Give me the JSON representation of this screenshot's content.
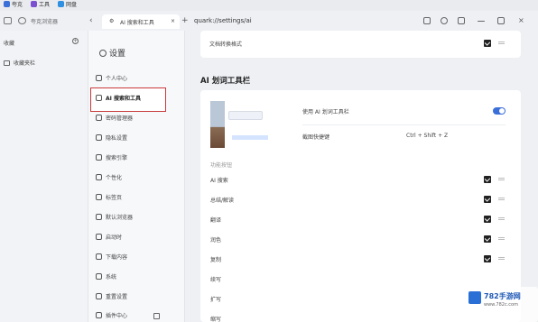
{
  "topbar": {
    "items": [
      {
        "label": "夸克",
        "color": "#3b6fd8"
      },
      {
        "label": "工具",
        "color": "#7a4fd0"
      },
      {
        "label": "网盘",
        "color": "#2f8fe0"
      }
    ]
  },
  "tabbar": {
    "tab_title": "夸克浏览器",
    "url_tab_label": "AI 搜索和工具",
    "address": "quark://settings/ai"
  },
  "left_panel": {
    "favorites_label": "收藏",
    "folder_label": "收藏夹栏"
  },
  "sidebar": {
    "title": "设置",
    "items": [
      {
        "label": "个人中心"
      },
      {
        "label": "AI 搜索和工具"
      },
      {
        "label": "密码管理器"
      },
      {
        "label": "隐私设置"
      },
      {
        "label": "搜索引擎"
      },
      {
        "label": "个性化"
      },
      {
        "label": "标签页"
      },
      {
        "label": "默认浏览器"
      },
      {
        "label": "启动时"
      },
      {
        "label": "下载内容"
      },
      {
        "label": "系统"
      },
      {
        "label": "重置设置"
      },
      {
        "label": "插件中心"
      }
    ]
  },
  "content": {
    "top_row_label": "文档转换格式",
    "section_title": "AI 划词工具栏",
    "enable_label": "使用 AI 划词工具栏",
    "shortcut_label": "截图快捷键",
    "shortcut_value": "Ctrl + Shift + Z",
    "tools_header": "功能按钮",
    "tools": [
      {
        "label": "AI 搜索",
        "checked": true
      },
      {
        "label": "总结/解读",
        "checked": true
      },
      {
        "label": "翻译",
        "checked": true
      },
      {
        "label": "润色",
        "checked": true
      },
      {
        "label": "复制",
        "checked": true
      },
      {
        "label": "续写",
        "checked": false
      },
      {
        "label": "扩写",
        "checked": false
      },
      {
        "label": "缩写",
        "checked": false
      }
    ]
  },
  "watermark": {
    "title": "782手游网",
    "url": "www.782c.com"
  }
}
